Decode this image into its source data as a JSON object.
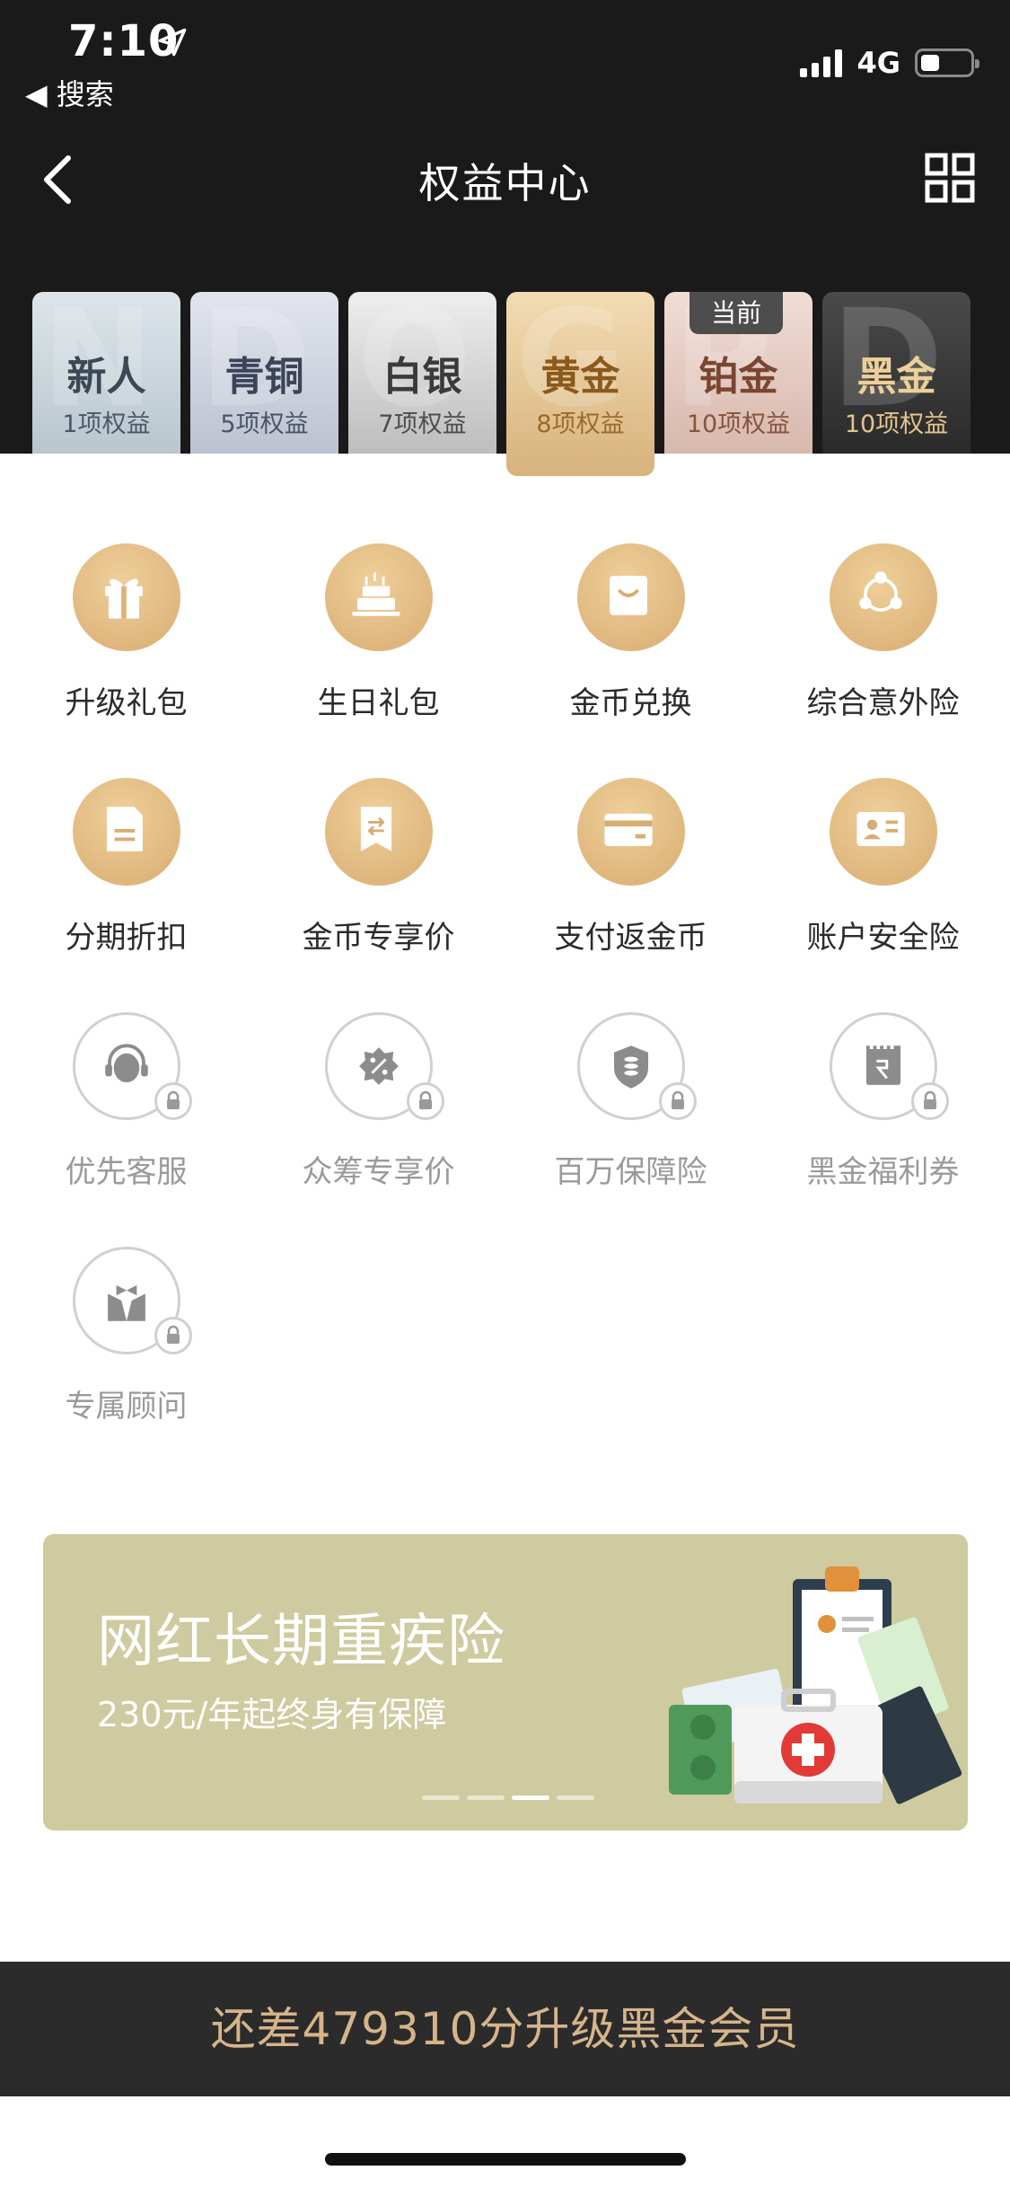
{
  "status_bar": {
    "time": "7:10",
    "back_app": "◀ 搜索",
    "network": "4G"
  },
  "nav": {
    "title": "权益中心"
  },
  "tiers": [
    {
      "name": "新人",
      "count": "1项权益",
      "watermark": "N"
    },
    {
      "name": "青铜",
      "count": "5项权益",
      "watermark": "D"
    },
    {
      "name": "白银",
      "count": "7项权益",
      "watermark": "O"
    },
    {
      "name": "黄金",
      "count": "8项权益",
      "watermark": "G"
    },
    {
      "name": "铂金",
      "count": "10项权益",
      "watermark": "P"
    },
    {
      "name": "黑金",
      "count": "10项权益",
      "watermark": "D"
    }
  ],
  "current_badge": "当前",
  "selected_tier": "黄金",
  "benefits": [
    {
      "label": "升级礼包",
      "icon": "gift-icon",
      "locked": false
    },
    {
      "label": "生日礼包",
      "icon": "cake-icon",
      "locked": false
    },
    {
      "label": "金币兑换",
      "icon": "shopping-bag-icon",
      "locked": false
    },
    {
      "label": "综合意外险",
      "icon": "triangle-network-icon",
      "locked": false
    },
    {
      "label": "分期折扣",
      "icon": "document-icon",
      "locked": false
    },
    {
      "label": "金币专享价",
      "icon": "price-tag-icon",
      "locked": false
    },
    {
      "label": "支付返金币",
      "icon": "card-icon",
      "locked": false
    },
    {
      "label": "账户安全险",
      "icon": "id-card-icon",
      "locked": false
    },
    {
      "label": "优先客服",
      "icon": "headset-icon",
      "locked": true
    },
    {
      "label": "众筹专享价",
      "icon": "percent-badge-icon",
      "locked": true
    },
    {
      "label": "百万保障险",
      "icon": "shield-coins-icon",
      "locked": true
    },
    {
      "label": "黑金福利券",
      "icon": "coupon-icon",
      "locked": true
    },
    {
      "label": "专属顾问",
      "icon": "advisor-bowtie-icon",
      "locked": true
    }
  ],
  "banner": {
    "title": "网红长期重疾险",
    "subtitle": "230元/年起终身有保障",
    "slide_count": 4,
    "active_slide": 3
  },
  "upgrade_text": "还差479310分升级黑金会员",
  "colors": {
    "header_bg": "#1a1a1a",
    "gold_icon": "#d8ad72",
    "banner_bg": "#cdcb9f",
    "upgrade_text": "#d6b48a"
  }
}
